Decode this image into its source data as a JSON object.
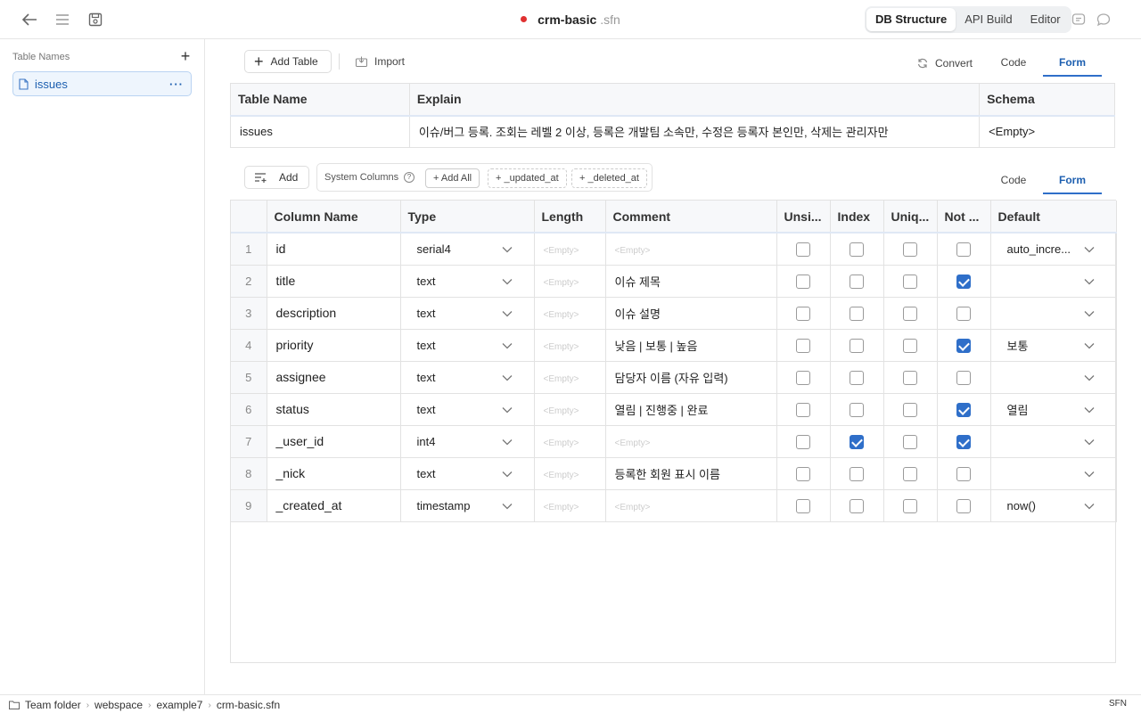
{
  "app": {
    "file_name": "crm-basic",
    "file_ext": ".sfn",
    "modes": [
      "DB Structure",
      "API Build",
      "Editor"
    ],
    "active_mode": "DB Structure"
  },
  "sidebar": {
    "header": "Table Names",
    "items": [
      {
        "label": "issues",
        "active": true
      }
    ]
  },
  "table_toolbar": {
    "add_table": "Add Table",
    "import": "Import",
    "convert": "Convert",
    "tabs": [
      "Code",
      "Form"
    ],
    "active_tab": "Form"
  },
  "table_info": {
    "headers": [
      "Table Name",
      "Explain",
      "Schema"
    ],
    "row": {
      "table_name": "issues",
      "explain": "이슈/버그 등록. 조회는 레벨 2 이상, 등록은 개발팀 소속만, 수정은 등록자 본인만, 삭제는 관리자만",
      "schema": "<Empty>"
    }
  },
  "column_toolbar": {
    "add": "Add",
    "system_columns": "System Columns",
    "add_all": "+ Add All",
    "updated_at": "+ _updated_at",
    "deleted_at": "+ _deleted_at",
    "tabs": [
      "Code",
      "Form"
    ],
    "active_tab": "Form"
  },
  "columns": {
    "headers": [
      "Column Name",
      "Type",
      "Length",
      "Comment",
      "Unsi...",
      "Index",
      "Uniq...",
      "Not ...",
      "Default"
    ],
    "empty_placeholder": "<Empty>",
    "rows": [
      {
        "num": "1",
        "name": "id",
        "type": "serial4",
        "length": "",
        "comment": "",
        "unsigned": false,
        "index": false,
        "unique": false,
        "not_null": false,
        "default": "auto_incre..."
      },
      {
        "num": "2",
        "name": "title",
        "type": "text",
        "length": "",
        "comment": "이슈 제목",
        "unsigned": false,
        "index": false,
        "unique": false,
        "not_null": true,
        "default": ""
      },
      {
        "num": "3",
        "name": "description",
        "type": "text",
        "length": "",
        "comment": "이슈 설명",
        "unsigned": false,
        "index": false,
        "unique": false,
        "not_null": false,
        "default": ""
      },
      {
        "num": "4",
        "name": "priority",
        "type": "text",
        "length": "",
        "comment": "낮음 | 보통 | 높음",
        "unsigned": false,
        "index": false,
        "unique": false,
        "not_null": true,
        "default": "보통"
      },
      {
        "num": "5",
        "name": "assignee",
        "type": "text",
        "length": "",
        "comment": "담당자 이름 (자유 입력)",
        "unsigned": false,
        "index": false,
        "unique": false,
        "not_null": false,
        "default": ""
      },
      {
        "num": "6",
        "name": "status",
        "type": "text",
        "length": "",
        "comment": "열림 | 진행중 | 완료",
        "unsigned": false,
        "index": false,
        "unique": false,
        "not_null": true,
        "default": "열림"
      },
      {
        "num": "7",
        "name": "_user_id",
        "type": "int4",
        "length": "",
        "comment": "",
        "unsigned": false,
        "index": true,
        "unique": false,
        "not_null": true,
        "default": ""
      },
      {
        "num": "8",
        "name": "_nick",
        "type": "text",
        "length": "",
        "comment": "등록한 회원 표시 이름",
        "unsigned": false,
        "index": false,
        "unique": false,
        "not_null": false,
        "default": ""
      },
      {
        "num": "9",
        "name": "_created_at",
        "type": "timestamp",
        "length": "",
        "comment": "",
        "unsigned": false,
        "index": false,
        "unique": false,
        "not_null": false,
        "default": "now()"
      }
    ]
  },
  "statusbar": {
    "breadcrumb": [
      "Team folder",
      "webspace",
      "example7",
      "crm-basic.sfn"
    ],
    "right": "SFN"
  }
}
